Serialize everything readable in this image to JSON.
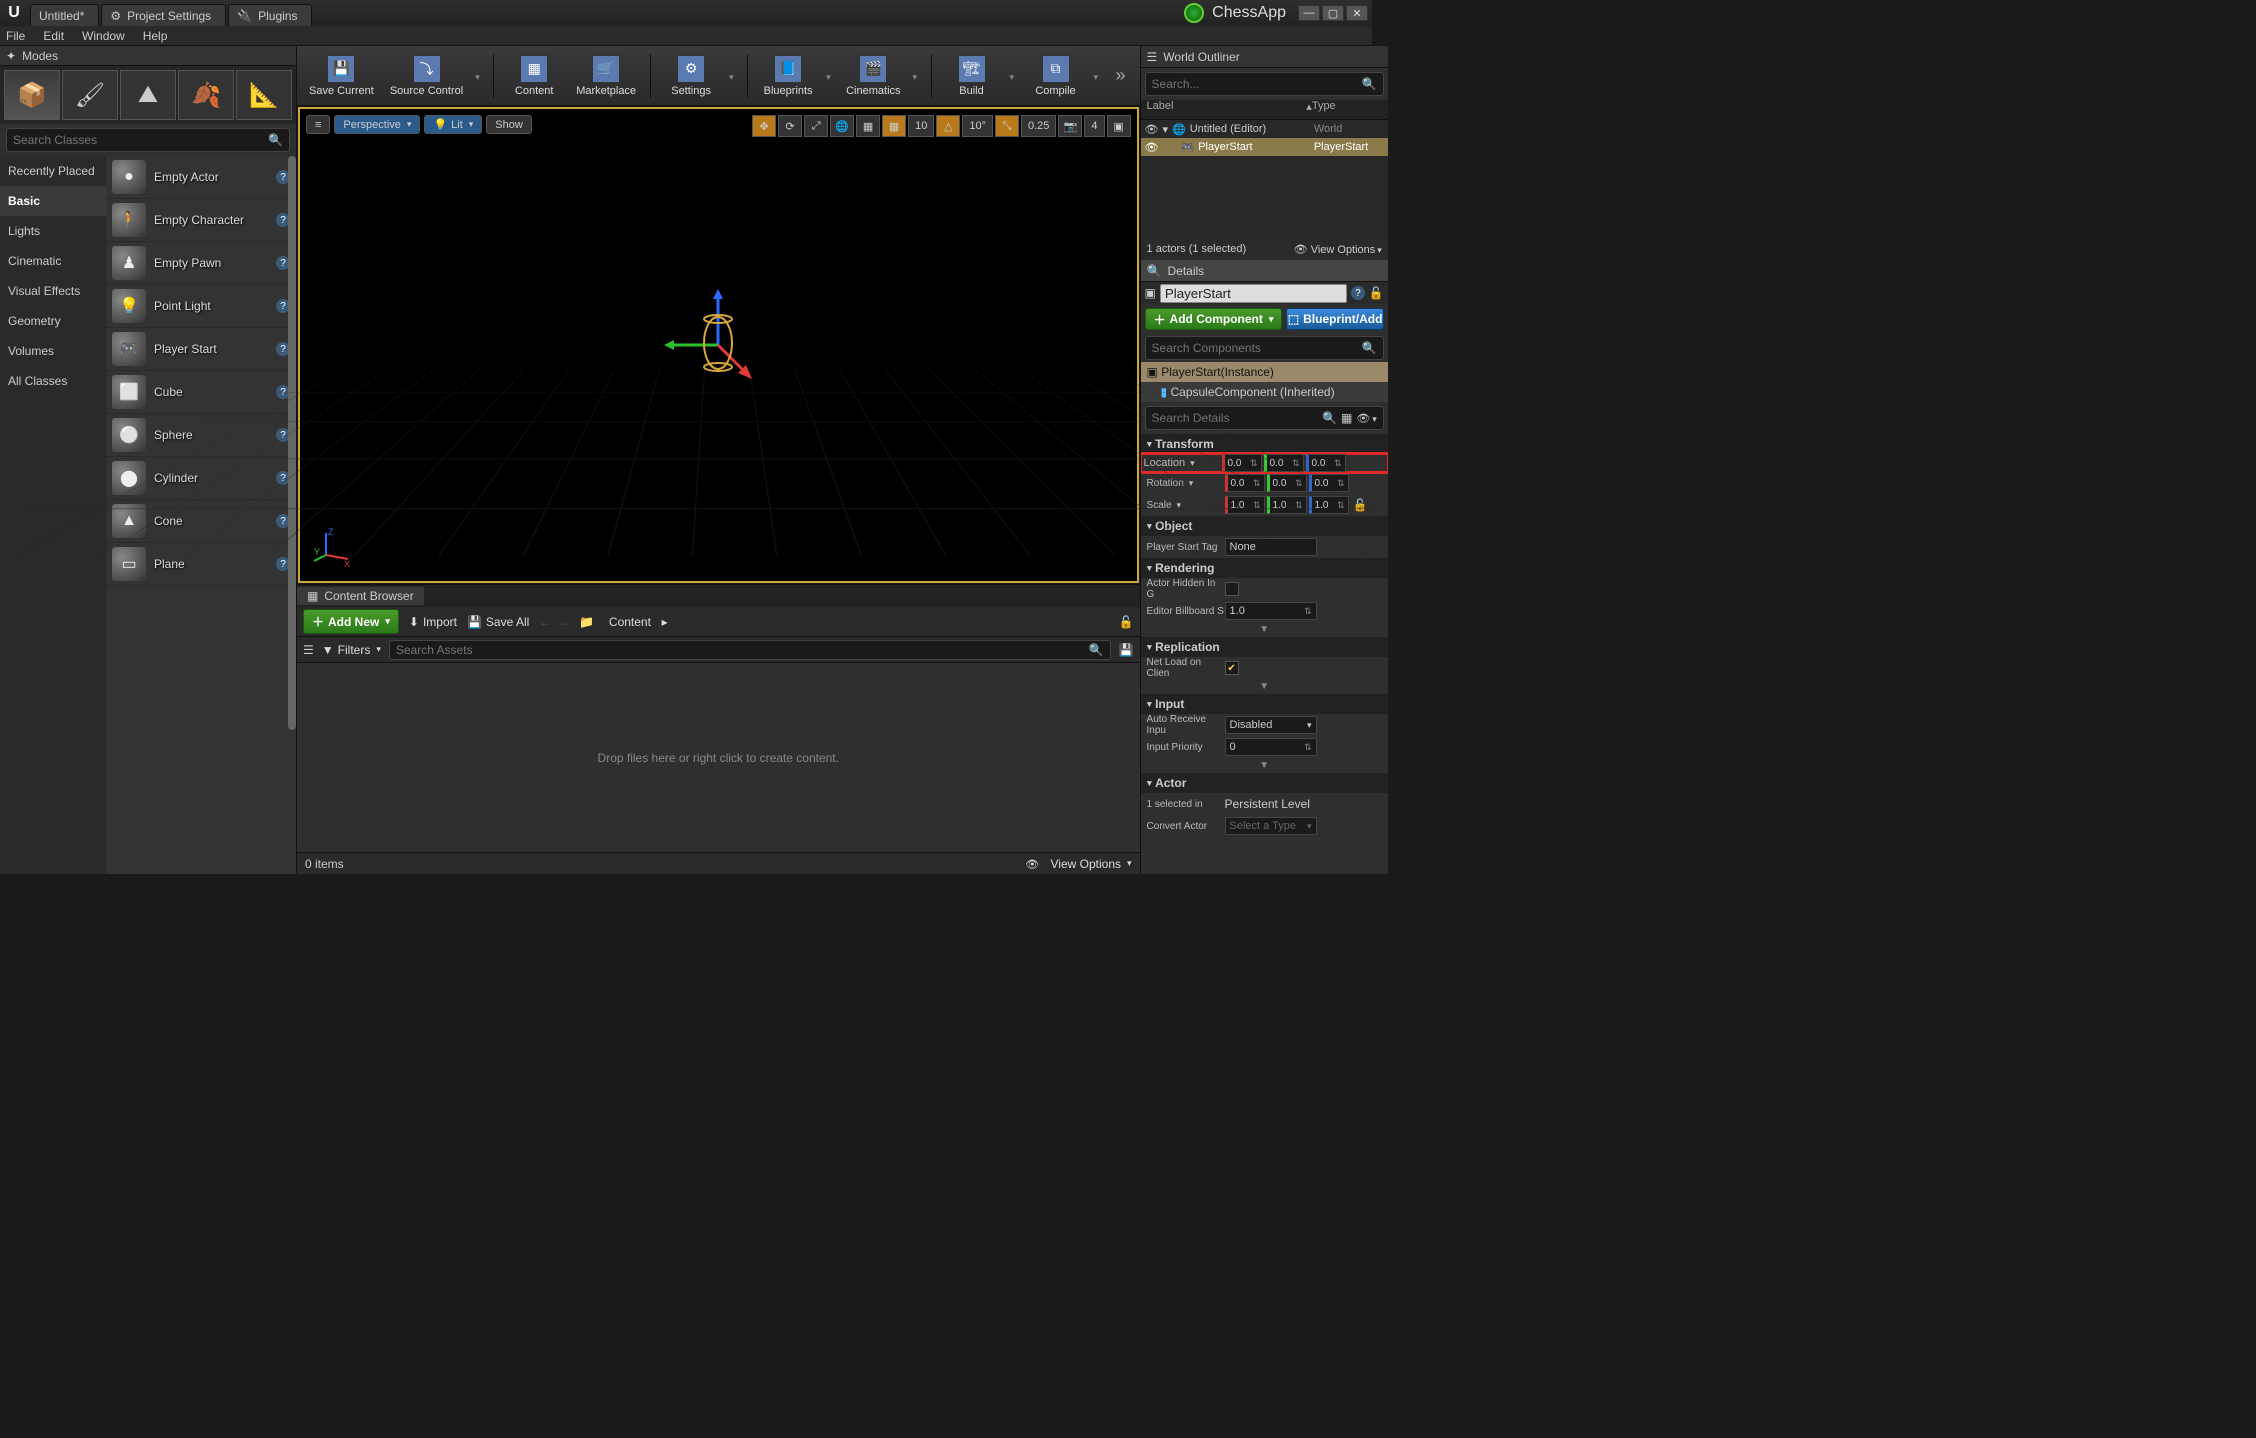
{
  "titlebar": {
    "tabs": [
      "Untitled*",
      "Project Settings",
      "Plugins"
    ],
    "app_name": "ChessApp"
  },
  "menu": {
    "items": [
      "File",
      "Edit",
      "Window",
      "Help"
    ]
  },
  "modes": {
    "title": "Modes",
    "search_placeholder": "Search Classes",
    "categories": [
      "Recently Placed",
      "Basic",
      "Lights",
      "Cinematic",
      "Visual Effects",
      "Geometry",
      "Volumes",
      "All Classes"
    ],
    "active_category": "Basic",
    "assets": [
      "Empty Actor",
      "Empty Character",
      "Empty Pawn",
      "Point Light",
      "Player Start",
      "Cube",
      "Sphere",
      "Cylinder",
      "Cone",
      "Plane"
    ]
  },
  "toolbar": {
    "save": "Save Current",
    "source_control": "Source Control",
    "content": "Content",
    "marketplace": "Marketplace",
    "settings": "Settings",
    "blueprints": "Blueprints",
    "cinematics": "Cinematics",
    "build": "Build",
    "compile": "Compile"
  },
  "viewport": {
    "menu": "≡",
    "perspective": "Perspective",
    "lit": "Lit",
    "show": "Show",
    "snap_angle": "10",
    "snap_angle2": "10°",
    "snap_scale": "0.25",
    "cam_speed": "4"
  },
  "content_browser": {
    "title": "Content Browser",
    "add_new": "Add New",
    "import": "Import",
    "save_all": "Save All",
    "path": "Content",
    "filters": "Filters",
    "search_placeholder": "Search Assets",
    "empty_hint": "Drop files here or right click to create content.",
    "item_count": "0 items",
    "view_options": "View Options"
  },
  "outliner": {
    "title": "World Outliner",
    "search_placeholder": "Search...",
    "col_label": "Label",
    "col_type": "Type",
    "rows": [
      {
        "label": "Untitled (Editor)",
        "type": "World",
        "sel": false
      },
      {
        "label": "PlayerStart",
        "type": "PlayerStart",
        "sel": true
      }
    ],
    "foot_count": "1 actors (1 selected)",
    "view_options": "View Options"
  },
  "details": {
    "title": "Details",
    "actor_name": "PlayerStart",
    "add_component": "Add Component",
    "blueprint_btn": "Blueprint/Add",
    "search_components_placeholder": "Search Components",
    "components": [
      {
        "name": "PlayerStart(Instance)",
        "root": true
      },
      {
        "name": "CapsuleComponent (Inherited)",
        "root": false
      }
    ],
    "search_details_placeholder": "Search Details",
    "sections": {
      "transform": {
        "title": "Transform",
        "location_label": "Location",
        "rotation_label": "Rotation",
        "scale_label": "Scale",
        "location": [
          "0.0",
          "0.0",
          "0.0"
        ],
        "rotation": [
          "0.0",
          "0.0",
          "0.0"
        ],
        "scale": [
          "1.0",
          "1.0",
          "1.0"
        ]
      },
      "object": {
        "title": "Object",
        "tag_label": "Player Start Tag",
        "tag_value": "None"
      },
      "rendering": {
        "title": "Rendering",
        "hidden_label": "Actor Hidden In G",
        "billboard_label": "Editor Billboard S",
        "billboard_value": "1.0"
      },
      "replication": {
        "title": "Replication",
        "net_label": "Net Load on Clien",
        "net_value": true
      },
      "input": {
        "title": "Input",
        "auto_label": "Auto Receive Inpu",
        "auto_value": "Disabled",
        "priority_label": "Input Priority",
        "priority_value": "0"
      },
      "actor": {
        "title": "Actor",
        "selected_label": "1 selected in",
        "selected_value": "Persistent Level",
        "convert_label": "Convert Actor",
        "convert_value": "Select a Type"
      }
    }
  }
}
